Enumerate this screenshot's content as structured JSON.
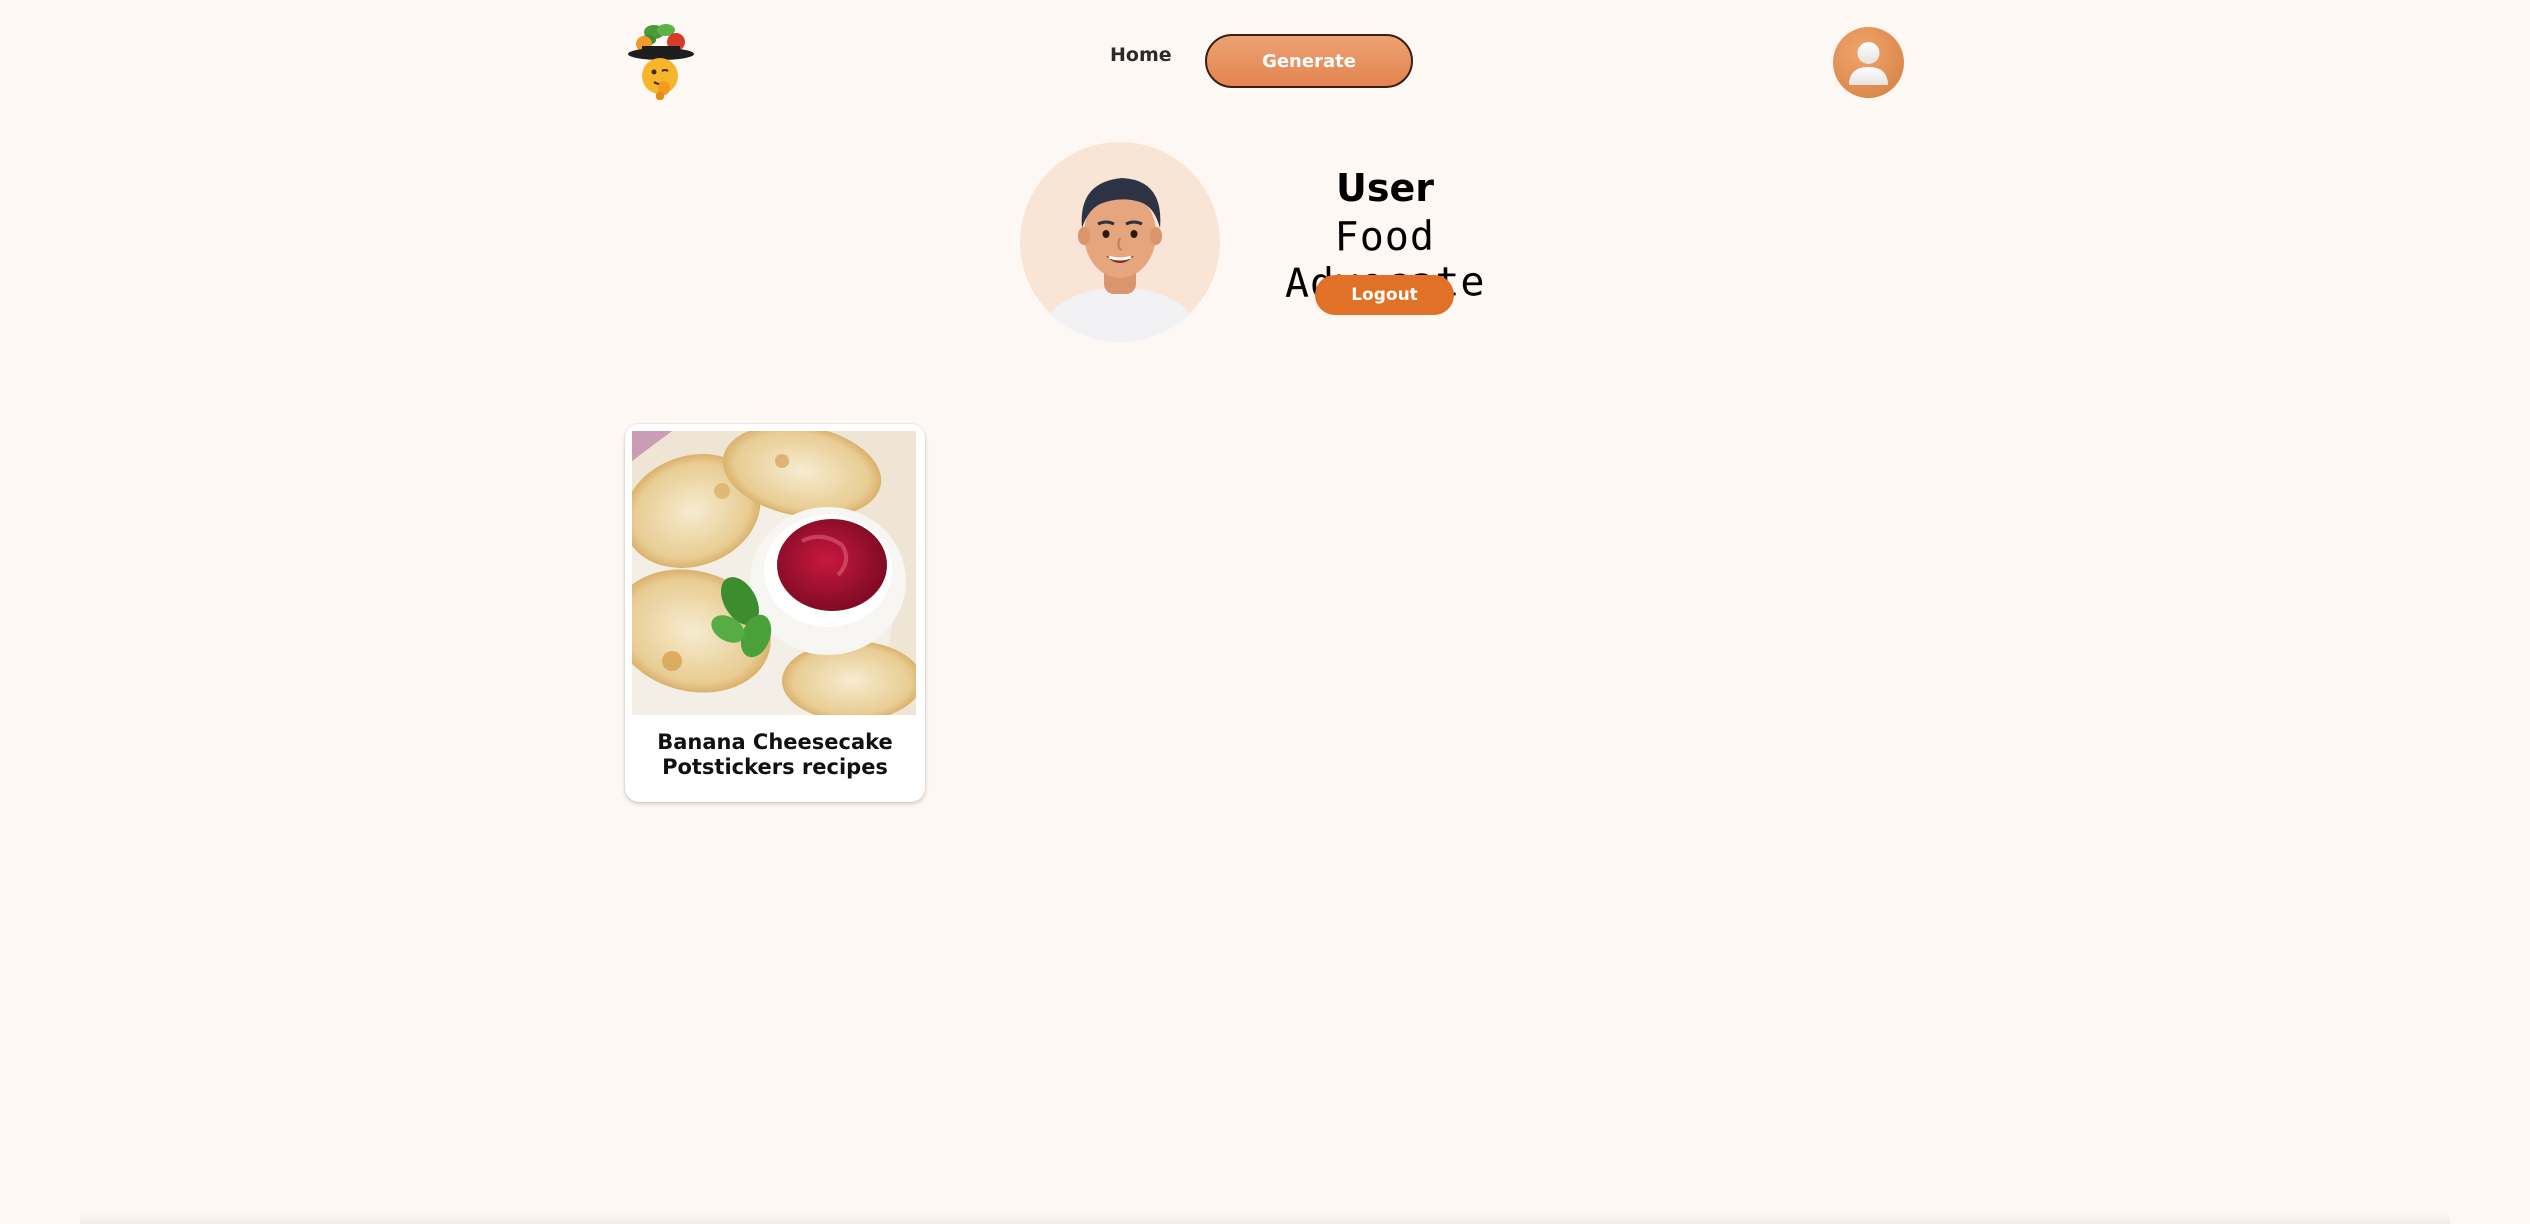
{
  "header": {
    "logo_icon": "chef-tomato-logo",
    "nav": {
      "home_label": "Home",
      "generate_label": "Generate"
    },
    "avatar_icon": "user-avatar-icon"
  },
  "profile": {
    "name": "User",
    "role": "Food Advocate",
    "logout_label": "Logout",
    "avatar_icon": "profile-avatar-illustration"
  },
  "recipes": [
    {
      "title": "Banana Cheesecake Potstickers recipes",
      "image_icon": "potstickers-with-berry-sauce-photo"
    }
  ],
  "colors": {
    "background": "#fef8f4",
    "accent": "#e07127",
    "generate_gradient_top": "#eda273",
    "generate_gradient_bottom": "#e28450"
  }
}
